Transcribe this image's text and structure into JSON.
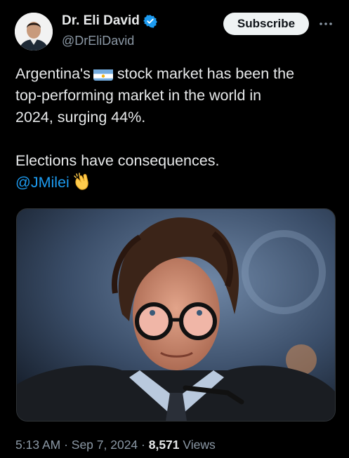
{
  "author": {
    "display_name": "Dr. Eli David",
    "handle": "@DrEliDavid",
    "verified": true,
    "verified_color": "#1d9bf0"
  },
  "actions": {
    "subscribe_label": "Subscribe",
    "more_icon": "more-horizontal-icon"
  },
  "tweet": {
    "line1_pre": "Argentina's",
    "line1_post": "stock market has been the",
    "flag_icon": "argentina-flag-emoji",
    "line2": "top-performing market in the world in",
    "line3": "2024, surging 44%.",
    "line4": "Elections have consequences.",
    "mention": "@JMilei",
    "clap_icon": "clapping-hands-emoji"
  },
  "media": {
    "description_icon": "photo-of-man-with-glasses"
  },
  "meta": {
    "time": "5:13 AM",
    "sep1": " · ",
    "date": "Sep 7, 2024",
    "sep2": " · ",
    "views_count": "8,571",
    "views_label": " Views"
  },
  "colors": {
    "background": "#000000",
    "text": "#e7e9ea",
    "secondary": "#8b98a5",
    "link": "#1d9bf0",
    "button_bg": "#eff3f4"
  }
}
